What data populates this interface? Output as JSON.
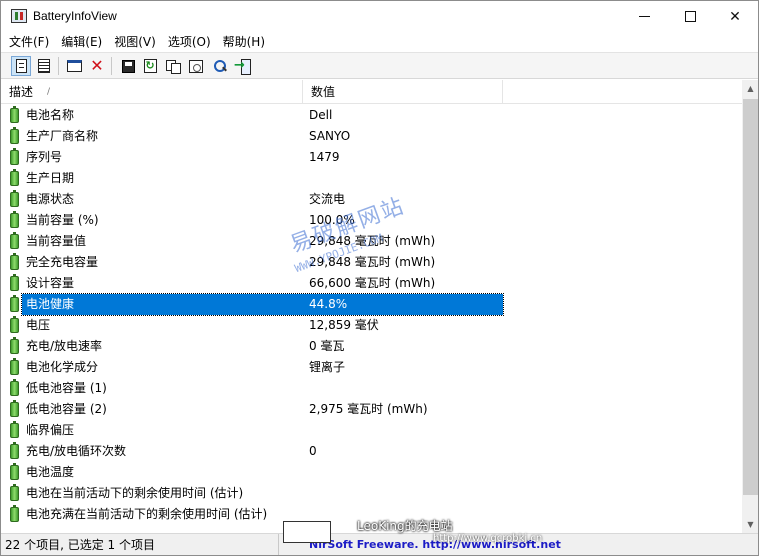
{
  "window": {
    "title": "BatteryInfoView",
    "controls": {
      "minimize": "minimize",
      "maximize": "maximize",
      "close": "✕"
    }
  },
  "menu": {
    "items": [
      "文件(F)",
      "编辑(E)",
      "视图(V)",
      "选项(O)",
      "帮助(H)"
    ]
  },
  "toolbar": {
    "buttons": [
      "document-view-icon",
      "grid-view-icon",
      "window-icon",
      "delete-icon",
      "save-icon",
      "refresh-icon",
      "copy-icon",
      "properties-icon",
      "find-icon",
      "exit-icon"
    ]
  },
  "list": {
    "columns": [
      "描述",
      "数值"
    ],
    "sort_indicator": "/",
    "rows": [
      {
        "desc": "电池名称",
        "value": "Dell"
      },
      {
        "desc": "生产厂商名称",
        "value": "SANYO"
      },
      {
        "desc": "序列号",
        "value": "1479"
      },
      {
        "desc": "生产日期",
        "value": ""
      },
      {
        "desc": "电源状态",
        "value": "交流电"
      },
      {
        "desc": "当前容量 (%)",
        "value": "100.0%"
      },
      {
        "desc": "当前容量值",
        "value": "29,848 毫瓦时 (mWh)"
      },
      {
        "desc": "完全充电容量",
        "value": "29,848 毫瓦时 (mWh)"
      },
      {
        "desc": "设计容量",
        "value": "66,600 毫瓦时 (mWh)"
      },
      {
        "desc": "电池健康",
        "value": "44.8%"
      },
      {
        "desc": "电压",
        "value": "12,859 毫伏"
      },
      {
        "desc": "充电/放电速率",
        "value": "0 毫瓦"
      },
      {
        "desc": "电池化学成分",
        "value": "锂离子"
      },
      {
        "desc": "低电池容量 (1)",
        "value": ""
      },
      {
        "desc": "低电池容量 (2)",
        "value": "2,975 毫瓦时 (mWh)"
      },
      {
        "desc": "临界偏压",
        "value": ""
      },
      {
        "desc": "充电/放电循环次数",
        "value": "0"
      },
      {
        "desc": "电池温度",
        "value": ""
      },
      {
        "desc": "电池在当前活动下的剩余使用时间 (估计)",
        "value": ""
      },
      {
        "desc": "电池充满在当前活动下的剩余使用时间 (估计)",
        "value": ""
      }
    ],
    "selected_index": 9
  },
  "watermark": {
    "text": "易破解网站",
    "url": "WWW.YPOJIE.COM"
  },
  "status": {
    "left": "22 个项目, 已选定 1 个项目",
    "link": "NirSoft Freeware.  http://www.nirsoft.net",
    "overlay_main": "LeoKing的充电站",
    "overlay_sub": "http://www.qcrobkj.cn"
  },
  "colors": {
    "selection": "#0078d7",
    "link": "#1c1cc6",
    "battery_green": "#3f9b2c"
  }
}
